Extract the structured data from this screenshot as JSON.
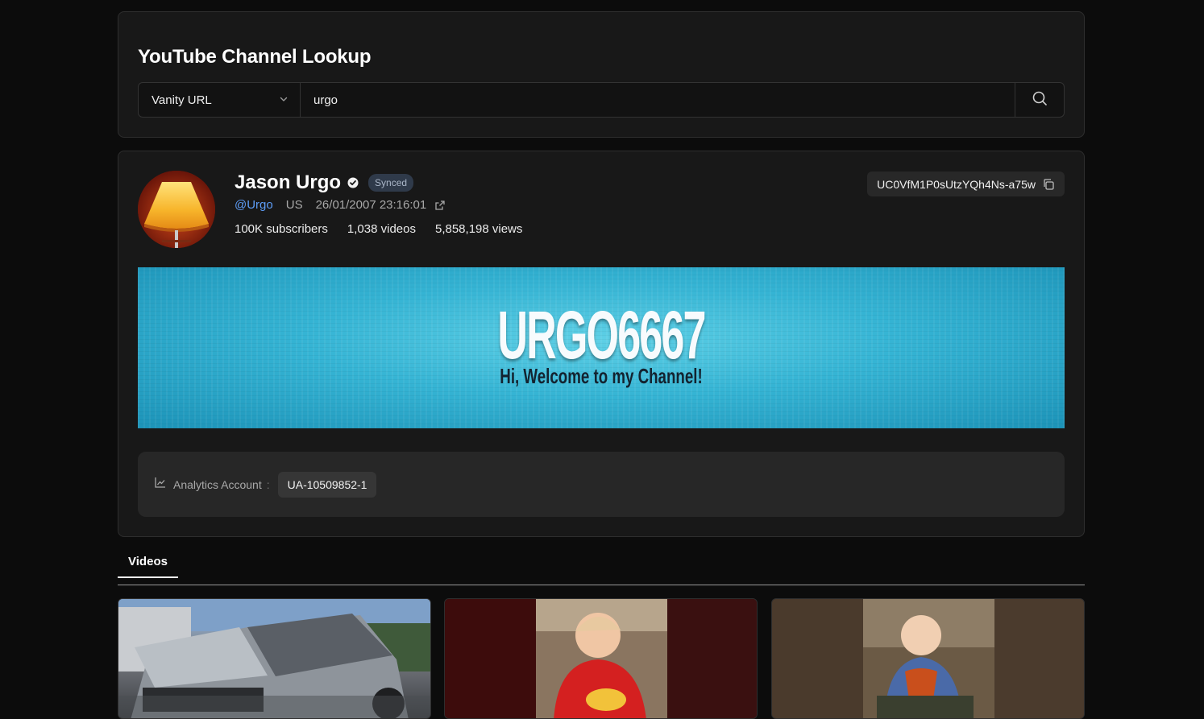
{
  "lookup": {
    "title": "YouTube Channel Lookup",
    "type_select": "Vanity URL",
    "query": "urgo",
    "search_icon": "search-icon"
  },
  "channel": {
    "name": "Jason Urgo",
    "verified_icon": "verified-check-icon",
    "synced_badge": "Synced",
    "handle": "@Urgo",
    "country": "US",
    "created": "26/01/2007 23:16:01",
    "subscribers": "100K subscribers",
    "videos": "1,038 videos",
    "views": "5,858,198 views",
    "channel_id": "UC0VfM1P0sUtzYQh4Ns-a75w",
    "banner": {
      "title": "URGO6667",
      "subtitle": "Hi, Welcome to my Channel!"
    },
    "analytics": {
      "label": "Analytics Account",
      "separator": ":",
      "value": "UA-10509852-1"
    }
  },
  "tabs": [
    {
      "label": "Videos",
      "active": true
    }
  ],
  "colors": {
    "background": "#0c0c0c",
    "card": "#181818",
    "accent_link": "#5d9cf5",
    "banner": "#35b4d4"
  }
}
